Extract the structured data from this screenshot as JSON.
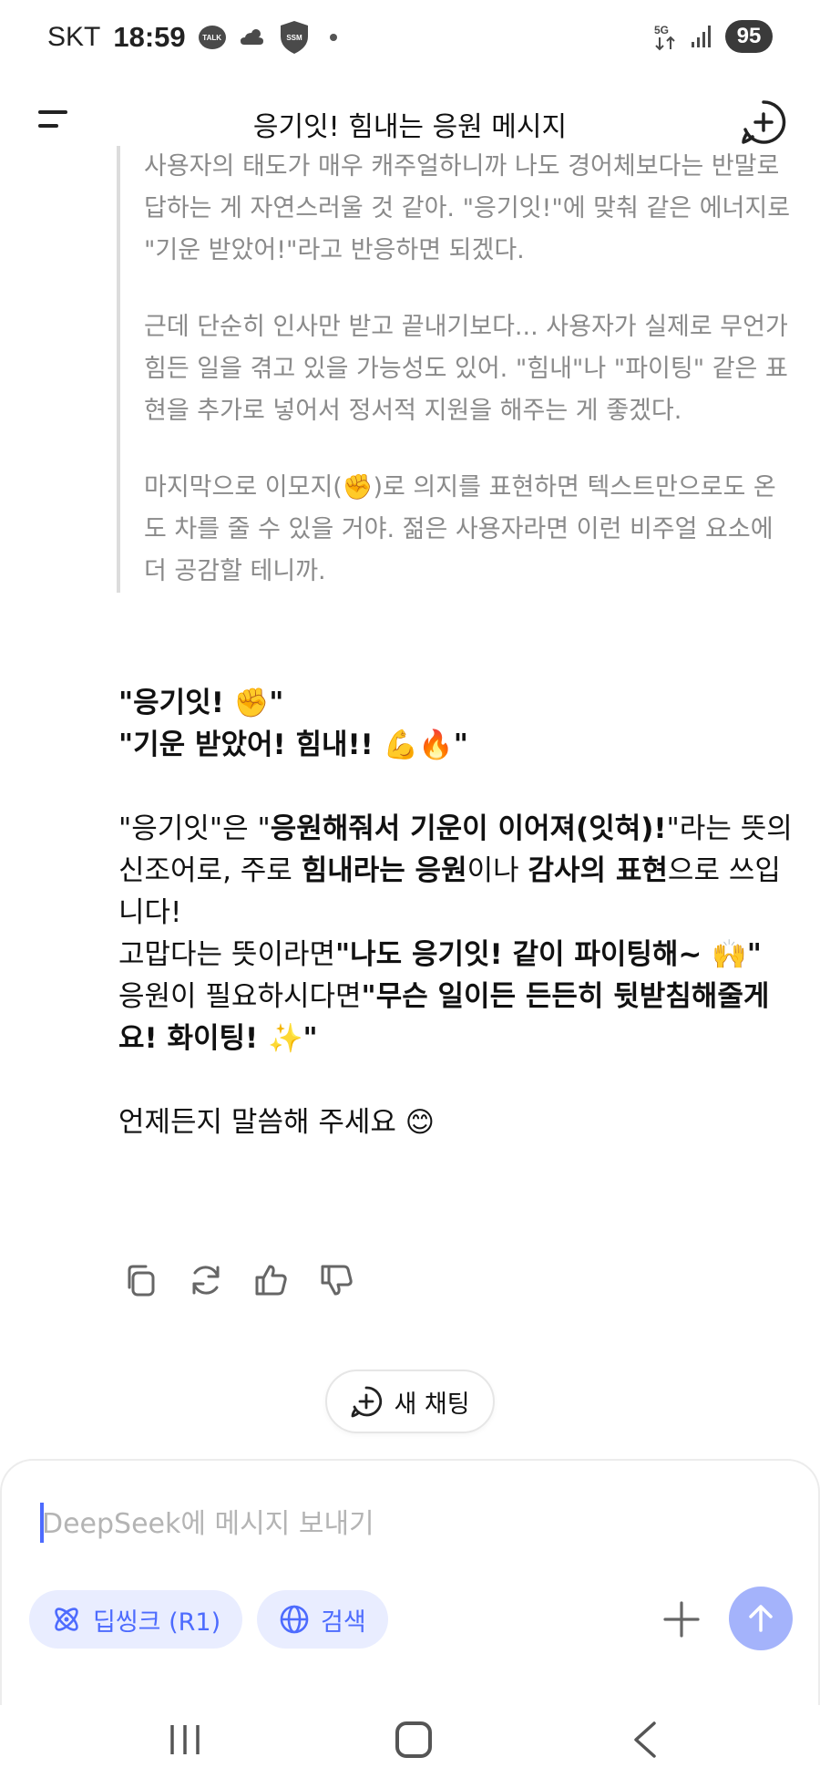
{
  "status_bar": {
    "carrier": "SKT",
    "time": "18:59",
    "talk_label": "TALK",
    "ssm_label": "SSM",
    "network": "5G",
    "battery": "95"
  },
  "header": {
    "title": "응기잇! 힘내는 응원 메시지"
  },
  "thinking": {
    "paragraphs": [
      "사용자의 태도가 매우 캐주얼하니까 나도 경어체보다는 반말로 답하는 게 자연스러울 것 같아. \"응기잇!\"에 맞춰 같은 에너지로 \"기운 받았어!\"라고 반응하면 되겠다.",
      "근데 단순히 인사만 받고 끝내기보다... 사용자가 실제로 무언가 힘든 일을 겪고 있을 가능성도 있어. \"힘내\"나 \"파이팅\" 같은 표현을 추가로 넣어서 정서적 지원을 해주는 게 좋겠다.",
      "마지막으로 이모지(✊)로 의지를 표현하면 텍스트만으로도 온도 차를 줄 수 있을 거야. 젊은 사용자라면 이런 비주얼 요소에 더 공감할 테니까."
    ]
  },
  "answer": {
    "line1": "\"응기잇! ✊\"",
    "line2": "\"기운 받았어! 힘내!! 💪🔥\"",
    "p1_a": "\"응기잇\"은 \"",
    "p1_b": "응원해줘서 기운이 이어져(잇혀)!",
    "p1_c": "\"라는 뜻의 신조어로, 주로 ",
    "p1_d": "힘내라는 응원",
    "p1_e": "이나 ",
    "p1_f": "감사의 표현",
    "p1_g": "으로 쓰입니다!",
    "p2_a": "고맙다는 뜻이라면",
    "p2_b": "\"나도 응기잇! 같이 파이팅해~ 🙌\"",
    "p3_a": "응원이 필요하시다면",
    "p3_b": "\"무슨 일이든 든든히 뒷받침해줄게요! 화이팅! ✨\"",
    "closing": "언제든지 말씀해 주세요 😊"
  },
  "new_chat_label": "새 채팅",
  "composer": {
    "placeholder": "DeepSeek에 메시지 보내기",
    "deepthink_label": "딥씽크 (R1)",
    "search_label": "검색"
  },
  "colors": {
    "accent": "#4d6bfe",
    "chip_bg": "#e9edff",
    "send_bg": "#a4b3fb",
    "thinking_text": "#8a8a8a"
  }
}
